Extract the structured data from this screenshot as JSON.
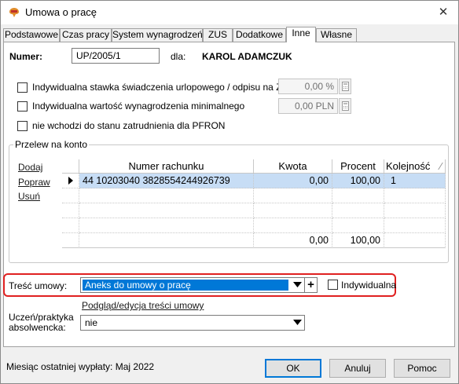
{
  "window": {
    "title": "Umowa o pracę",
    "close_glyph": "✕",
    "app_icon": "gt-app-icon"
  },
  "tabs": [
    {
      "label": "Podstawowe",
      "active": false
    },
    {
      "label": "Czas pracy",
      "active": false
    },
    {
      "label": "System wynagrodzeń",
      "active": false
    },
    {
      "label": "ZUS",
      "active": false
    },
    {
      "label": "Dodatkowe",
      "active": false
    },
    {
      "label": "Inne",
      "active": true
    },
    {
      "label": "Własne",
      "active": false
    }
  ],
  "header": {
    "numer_label": "Numer:",
    "numer_value": "UP/2005/1",
    "dla_label": "dla:",
    "employee_name": "KAROL ADAMCZUK"
  },
  "options": {
    "stawka_label": "Indywidualna stawka świadczenia urlopowego / odpisu na ZFŚS",
    "stawka_value": "0,00 %",
    "wynagrodzenie_label": "Indywidualna wartość wynagrodzenia minimalnego",
    "wynagrodzenie_value": "0,00 PLN",
    "pfron_label": "nie wchodzi do stanu zatrudnienia dla PFRON"
  },
  "przelew": {
    "group_title": "Przelew na konto",
    "links": {
      "add": "Dodaj",
      "edit": "Popraw",
      "delete": "Usuń"
    },
    "columns": [
      "Numer rachunku",
      "Kwota",
      "Procent",
      "Kolejność"
    ],
    "sort_glyph": "⁄",
    "rows": [
      {
        "account": "44 10203040 3828554244926739",
        "kwota": "0,00",
        "procent": "100,00",
        "kolejnosc": "1"
      }
    ],
    "totals": {
      "kwota": "0,00",
      "procent": "100,00"
    }
  },
  "tresc": {
    "label": "Treść umowy:",
    "selected": "Aneks do umowy o pracę",
    "plus_glyph": "+",
    "indywidualna_label": "Indywidualna",
    "preview_link": "Podgląd/edycja treści umowy"
  },
  "uczen": {
    "label_line1": "Uczeń/praktyka",
    "label_line2": "absolwencka:",
    "value": "nie"
  },
  "footer": {
    "last_payment": "Miesiąc ostatniej wypłaty: Maj 2022",
    "ok": "OK",
    "cancel": "Anuluj",
    "help": "Pomoc"
  },
  "colors": {
    "highlight": "#e02020",
    "selection": "#0078d7",
    "row_selection": "#c7ddf5"
  }
}
